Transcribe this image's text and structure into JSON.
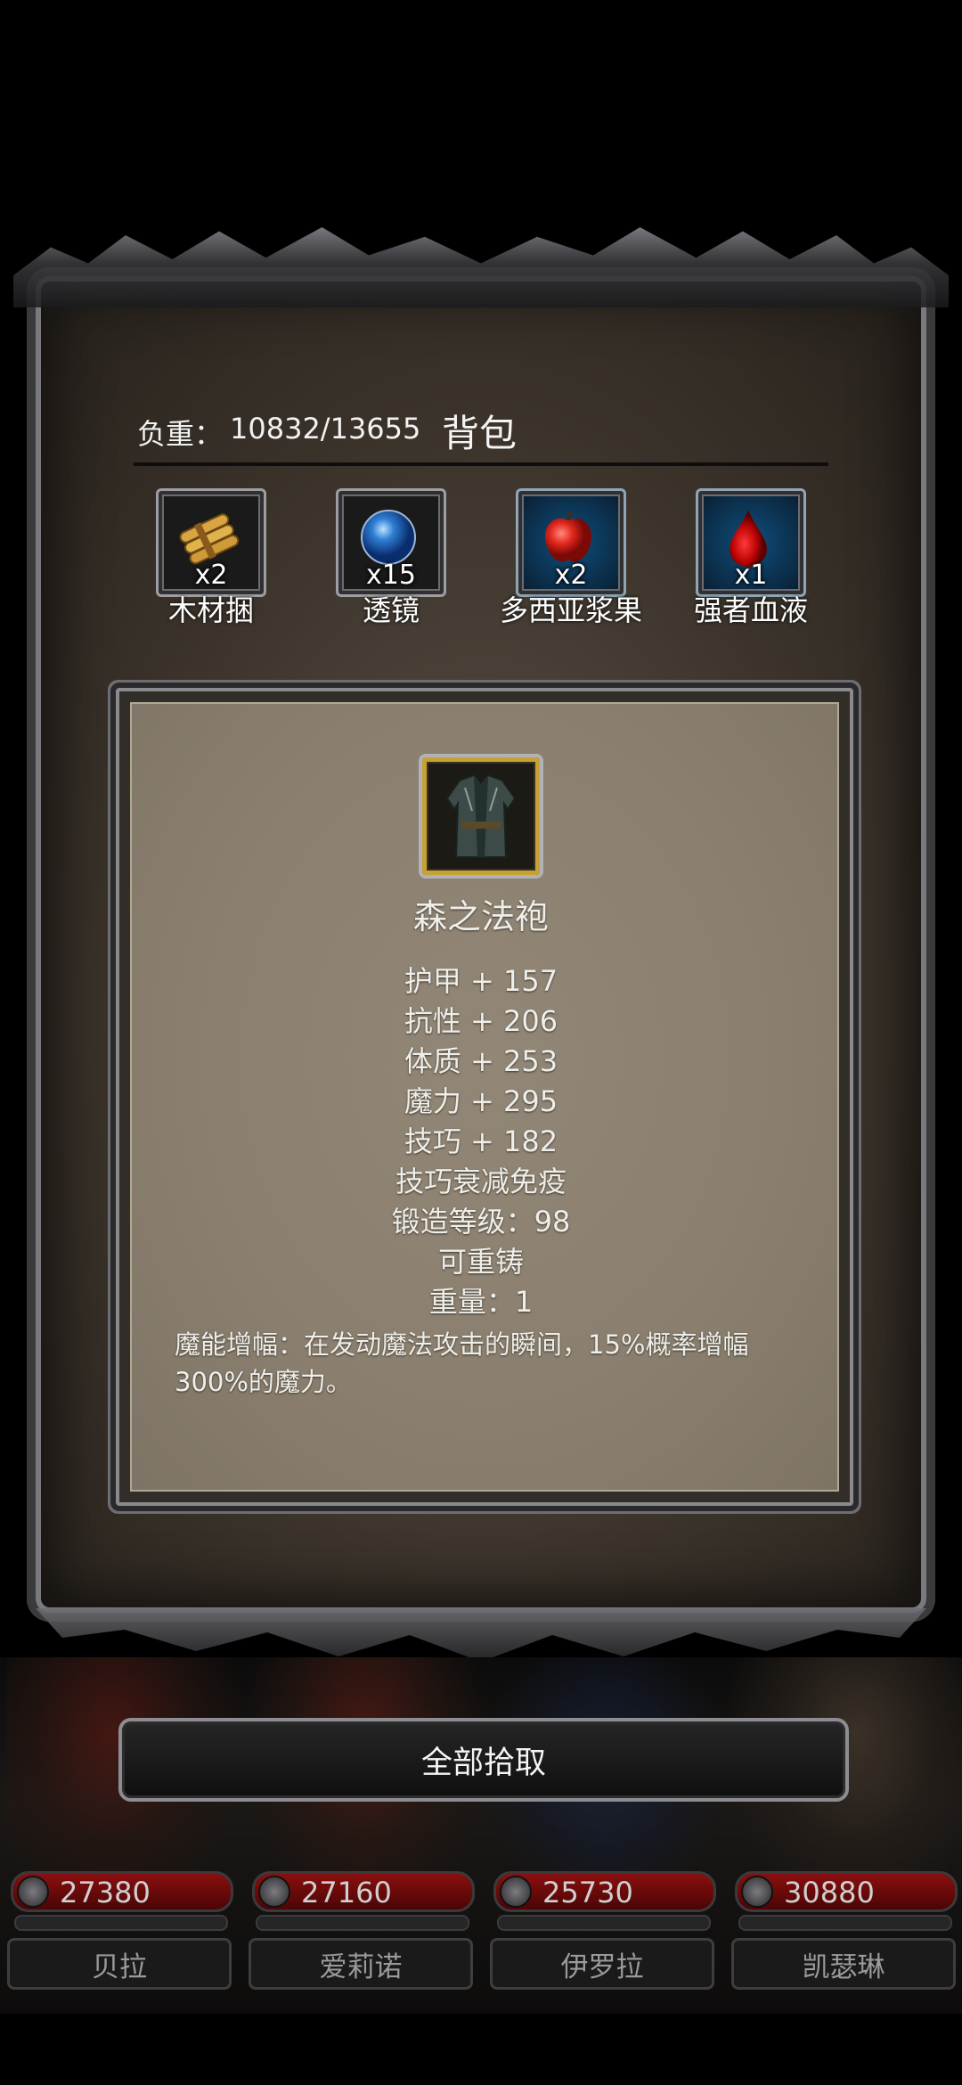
{
  "header": {
    "load_label": "负重：",
    "load_value": "10832/13655",
    "title": "背包"
  },
  "items": [
    {
      "name": "木材捆",
      "count": "x2",
      "icon": "wood-bundle-icon"
    },
    {
      "name": "透镜",
      "count": "x15",
      "icon": "blue-lens-icon"
    },
    {
      "name": "多西亚浆果",
      "count": "x2",
      "icon": "red-apple-icon"
    },
    {
      "name": "强者血液",
      "count": "x1",
      "icon": "blood-drop-icon"
    }
  ],
  "tooltip": {
    "icon": "robe-icon",
    "name": "森之法袍",
    "stats": [
      "护甲 + 157",
      "抗性 + 206",
      "体质 + 253",
      "魔力 + 295",
      "技巧 + 182",
      "技巧衰减免疫",
      "锻造等级：98",
      "可重铸",
      "重量：1"
    ],
    "effect": "魔能增幅：在发动魔法攻击的瞬间，15%概率增幅300%的魔力。"
  },
  "pickup_all_label": "全部拾取",
  "party": [
    {
      "name": "贝拉",
      "hp": "27380"
    },
    {
      "name": "爱莉诺",
      "hp": "27160"
    },
    {
      "name": "伊罗拉",
      "hp": "25730"
    },
    {
      "name": "凯瑟琳",
      "hp": "30880"
    }
  ],
  "colors": {
    "hp_bar": "#8a0f0f",
    "slot_highlight": "#0f4e7c",
    "tooltip_bg": "#8a7f6f",
    "icon_frame_gold": "#c6a232"
  }
}
